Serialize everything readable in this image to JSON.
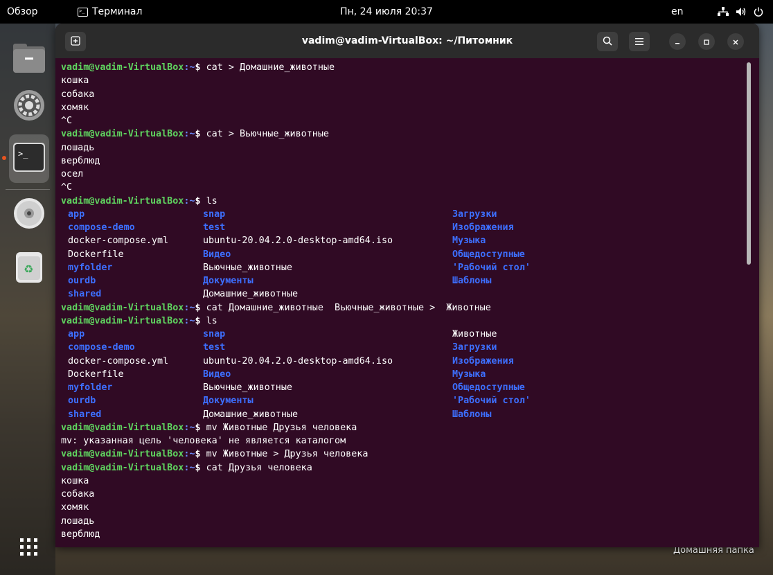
{
  "topbar": {
    "overview": "Обзор",
    "app_name": "Терминал",
    "app_icon": "terminal-icon",
    "clock": "Пн, 24 июля 20:37",
    "lang": "en",
    "tray_icons": [
      "network-icon",
      "volume-icon",
      "power-icon"
    ]
  },
  "dock": {
    "items": [
      "files-icon",
      "settings-icon",
      "terminal-icon",
      "optical-disc-icon",
      "trash-icon",
      "app-grid-icon"
    ]
  },
  "desktop": {
    "home_label": "Домашняя папка"
  },
  "window": {
    "title": "vadim@vadim-VirtualBox: ~/Питомник",
    "buttons": [
      "new-tab",
      "search",
      "menu",
      "minimize",
      "maximize",
      "close"
    ]
  },
  "terminal": {
    "prompt_user": "vadim@vadim-VirtualBox",
    "prompt_path": ":~",
    "prompt_dollar": "$ ",
    "lines": [
      {
        "type": "cmd",
        "text": "cat > Домашние_животные"
      },
      {
        "type": "out",
        "text": "кошка"
      },
      {
        "type": "out",
        "text": "собака"
      },
      {
        "type": "out",
        "text": "хомяк"
      },
      {
        "type": "out",
        "text": "^C"
      },
      {
        "type": "cmd",
        "text": "cat > Вьючные_животные"
      },
      {
        "type": "out",
        "text": "лошадь"
      },
      {
        "type": "out",
        "text": "верблюд"
      },
      {
        "type": "out",
        "text": "осел"
      },
      {
        "type": "out",
        "text": "^C"
      },
      {
        "type": "cmd",
        "text": "ls"
      },
      {
        "type": "ls",
        "cols": [
          {
            "t": "app",
            "d": true
          },
          {
            "t": "snap",
            "d": true
          },
          {
            "t": "Загрузки",
            "d": true
          }
        ]
      },
      {
        "type": "ls",
        "cols": [
          {
            "t": "compose-demo",
            "d": true
          },
          {
            "t": "test",
            "d": true
          },
          {
            "t": "Изображения",
            "d": true
          }
        ]
      },
      {
        "type": "ls",
        "cols": [
          {
            "t": "docker-compose.yml",
            "d": false
          },
          {
            "t": "ubuntu-20.04.2.0-desktop-amd64.iso",
            "d": false
          },
          {
            "t": "Музыка",
            "d": true
          }
        ]
      },
      {
        "type": "ls",
        "cols": [
          {
            "t": "Dockerfile",
            "d": false
          },
          {
            "t": "Видео",
            "d": true
          },
          {
            "t": "Общедоступные",
            "d": true
          }
        ]
      },
      {
        "type": "ls",
        "cols": [
          {
            "t": "myfolder",
            "d": true
          },
          {
            "t": "Вьючные_животные",
            "d": false
          },
          {
            "t": "'Рабочий стол'",
            "d": true
          }
        ]
      },
      {
        "type": "ls",
        "cols": [
          {
            "t": "ourdb",
            "d": true
          },
          {
            "t": "Документы",
            "d": true
          },
          {
            "t": "Шаблоны",
            "d": true
          }
        ]
      },
      {
        "type": "ls",
        "cols": [
          {
            "t": "shared",
            "d": true
          },
          {
            "t": "Домашние_животные",
            "d": false
          },
          {
            "t": "",
            "d": false
          }
        ]
      },
      {
        "type": "cmd",
        "text": "cat Домашние_животные  Вьючные_животные >  Животные"
      },
      {
        "type": "cmd",
        "text": "ls"
      },
      {
        "type": "ls",
        "cols": [
          {
            "t": "app",
            "d": true
          },
          {
            "t": "snap",
            "d": true
          },
          {
            "t": "Животные",
            "d": false
          }
        ]
      },
      {
        "type": "ls",
        "cols": [
          {
            "t": "compose-demo",
            "d": true
          },
          {
            "t": "test",
            "d": true
          },
          {
            "t": "Загрузки",
            "d": true
          }
        ]
      },
      {
        "type": "ls",
        "cols": [
          {
            "t": "docker-compose.yml",
            "d": false
          },
          {
            "t": "ubuntu-20.04.2.0-desktop-amd64.iso",
            "d": false
          },
          {
            "t": "Изображения",
            "d": true
          }
        ]
      },
      {
        "type": "ls",
        "cols": [
          {
            "t": "Dockerfile",
            "d": false
          },
          {
            "t": "Видео",
            "d": true
          },
          {
            "t": "Музыка",
            "d": true
          }
        ]
      },
      {
        "type": "ls",
        "cols": [
          {
            "t": "myfolder",
            "d": true
          },
          {
            "t": "Вьючные_животные",
            "d": false
          },
          {
            "t": "Общедоступные",
            "d": true
          }
        ]
      },
      {
        "type": "ls",
        "cols": [
          {
            "t": "ourdb",
            "d": true
          },
          {
            "t": "Документы",
            "d": true
          },
          {
            "t": "'Рабочий стол'",
            "d": true
          }
        ]
      },
      {
        "type": "ls",
        "cols": [
          {
            "t": "shared",
            "d": true
          },
          {
            "t": "Домашние_животные",
            "d": false
          },
          {
            "t": "Шаблоны",
            "d": true
          }
        ]
      },
      {
        "type": "cmd",
        "text": "mv Животные Друзья человека"
      },
      {
        "type": "out",
        "text": "mv: указанная цель 'человека' не является каталогом"
      },
      {
        "type": "cmd",
        "text": "mv Животные > Друзья человека"
      },
      {
        "type": "cmd",
        "text": "cat Друзья человека"
      },
      {
        "type": "out",
        "text": "кошка"
      },
      {
        "type": "out",
        "text": "собака"
      },
      {
        "type": "out",
        "text": "хомяк"
      },
      {
        "type": "out",
        "text": "лошадь"
      },
      {
        "type": "out",
        "text": "верблюд"
      }
    ]
  },
  "colors": {
    "terminal_bg": "#300a24",
    "prompt_user": "#5fd35f",
    "prompt_path": "#6a8cff",
    "directory": "#3d6fff",
    "titlebar": "#2b2b2b",
    "accent": "#e95420"
  }
}
